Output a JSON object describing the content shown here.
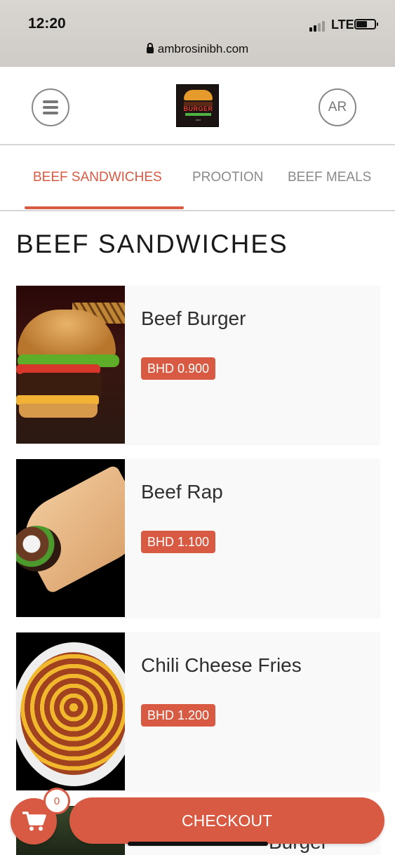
{
  "statusbar": {
    "time": "12:20",
    "network": "LTE",
    "url": "ambrosinibh.com"
  },
  "header": {
    "lang_button": "AR"
  },
  "tabs": [
    {
      "label": "BEEF SANDWICHES",
      "active": true
    },
    {
      "label": "PROOTION",
      "active": false
    },
    {
      "label": "BEEF MEALS",
      "active": false
    }
  ],
  "section_title": "BEEF SANDWICHES",
  "products": [
    {
      "name": "Beef Burger",
      "price": "BHD 0.900",
      "image": "beef-burger-photo"
    },
    {
      "name": "Beef Rap",
      "price": "BHD 1.100",
      "image": "beef-wrap-photo"
    },
    {
      "name": "Chili Cheese Fries",
      "price": "BHD 1.200",
      "image": "chili-cheese-fries-photo"
    },
    {
      "name": "Burger",
      "price": "",
      "image": "burger-photo"
    }
  ],
  "cart": {
    "count": "0",
    "checkout_label": "CHECKOUT"
  },
  "colors": {
    "accent": "#d85a42",
    "tab_inactive": "#8a8a8a",
    "card_bg": "#f9f9f9"
  }
}
